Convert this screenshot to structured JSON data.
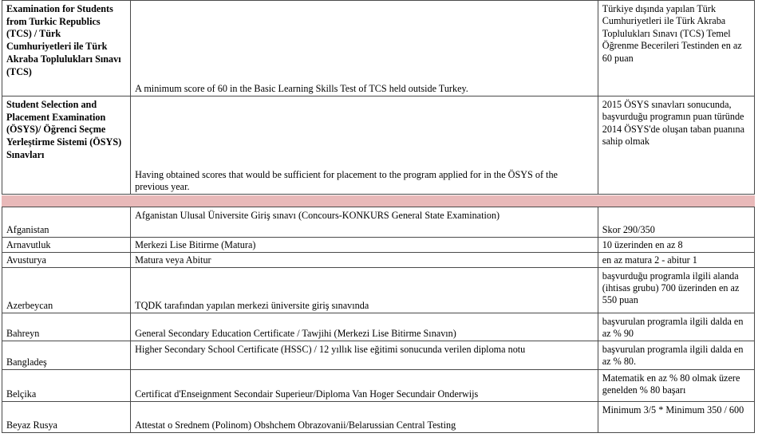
{
  "document": {
    "type": "equivalency-table",
    "separator_color": "#e8b9b9",
    "border_color": "#4a4a4a"
  },
  "header_table": {
    "rows": [
      {
        "exam_name": "Examination for Students from Turkic Republics (TCS) / Türk Cumhuriyetleri ile Türk Akraba Toplulukları Sınavı (TCS)",
        "requirement_en": "A minimum score of 60 in the Basic Learning Skills Test of TCS held outside Turkey.",
        "requirement_tr": "Türkiye dışında yapılan Türk Cumhuriyetleri ile Türk Akraba Toplulukları Sınavı (TCS) Temel Öğrenme Becerileri Testinden en az 60 puan"
      },
      {
        "exam_name": "Student Selection and Placement Examination (ÖSYS)/ Öğrenci Seçme Yerleştirme Sistemi (ÖSYS) Sınavları",
        "requirement_en": "Having obtained scores that would be sufficient for placement to the program applied for in the ÖSYS of the previous year.",
        "requirement_tr": "2015 ÖSYS sınavları sonucunda, başvurduğu programın puan türünde 2014 ÖSYS'de oluşan taban puanına sahip olmak"
      }
    ]
  },
  "country_table": {
    "rows": [
      {
        "country": "Afganistan",
        "exam": "Afganistan Ulusal Üniversite Giriş sınavı (Concours-KONKURS General State Examination)",
        "score": "Skor 290/350"
      },
      {
        "country": "Arnavutluk",
        "exam": "Merkezi Lise Bitirme (Matura)",
        "score": " 10 üzerinden en az 8"
      },
      {
        "country": "Avusturya",
        "exam": "Matura veya Abitur",
        "score": "en az matura 2 - abitur 1"
      },
      {
        "country": "Azerbeycan",
        "exam": "TQDK tarafından yapılan merkezi üniversite giriş sınavında",
        "score": "başvurduğu programla ilgili alanda (ihtisas grubu) 700 üzerinden en az 550 puan"
      },
      {
        "country": "Bahreyn",
        "exam": "General Secondary Education Certificate / Tawjihi (Merkezi Lise Bitirme Sınavın)",
        "score": "başvurulan programla ilgili dalda en az % 90"
      },
      {
        "country": "Bangladeş",
        "exam": "Higher Secondary School Certificate (HSSC) / 12 yıllık lise eğitimi sonucunda verilen diploma notu",
        "score": "başvurulan programla ilgili dalda en az % 80."
      },
      {
        "country": "Belçika",
        "exam": "Certificat d'Enseignment Secondair Superieur/Diploma Van Hoger Secundair Onderwijs",
        "score": "Matematik en az % 80 olmak üzere genelden % 80 başarı"
      },
      {
        "country": "Beyaz Rusya",
        "exam": "Attestat o Srednem (Polinom) Obshchem Obrazovanii/Belarussian Central Testing",
        "score": "Minimum 3/5 * Minimum 350 / 600"
      }
    ]
  }
}
